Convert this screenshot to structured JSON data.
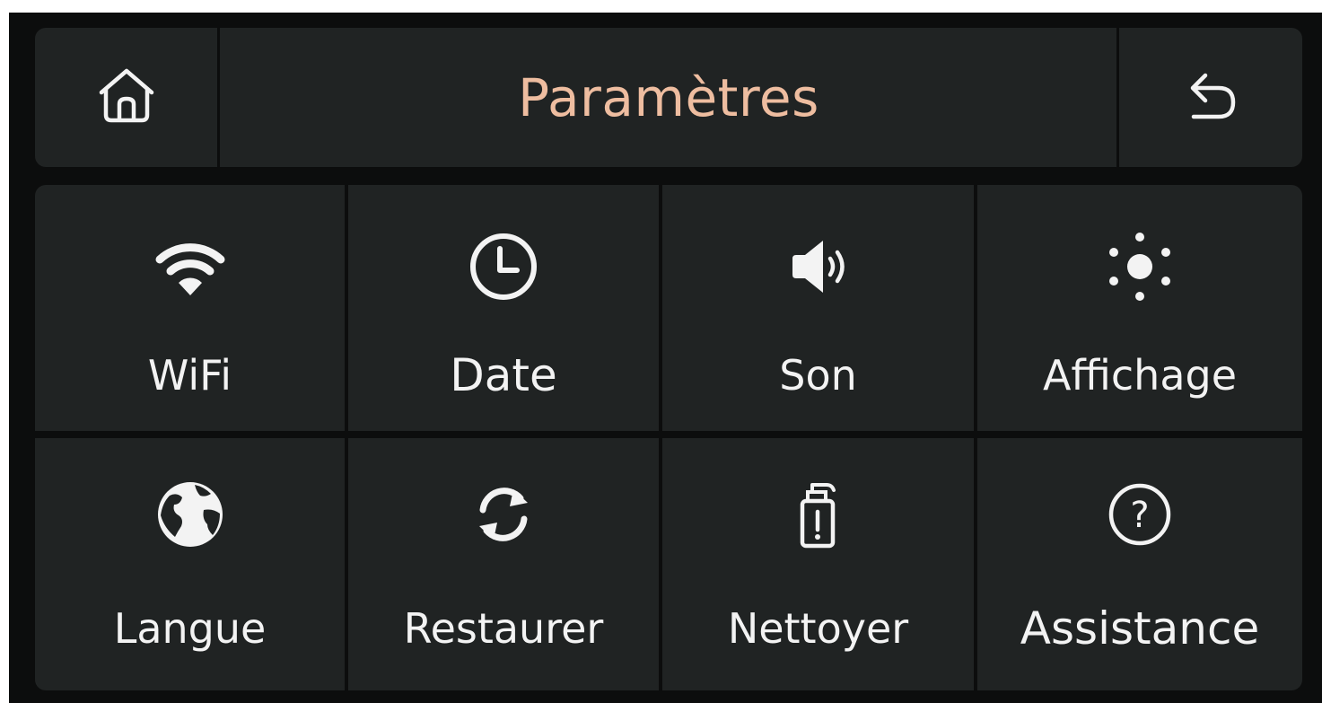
{
  "header": {
    "title": "Paramètres",
    "title_color": "#eebda0",
    "home_icon": "home-icon",
    "back_icon": "back-arrow-icon"
  },
  "menu": {
    "items": [
      {
        "label": "WiFi",
        "icon": "wifi-icon"
      },
      {
        "label": "Date",
        "icon": "clock-icon"
      },
      {
        "label": "Son",
        "icon": "speaker-icon"
      },
      {
        "label": "Affichage",
        "icon": "brightness-icon"
      },
      {
        "label": "Langue",
        "icon": "globe-icon"
      },
      {
        "label": "Restaurer",
        "icon": "restore-icon"
      },
      {
        "label": "Nettoyer",
        "icon": "cleaner-bottle-icon"
      },
      {
        "label": "Assistance",
        "icon": "help-icon"
      }
    ]
  },
  "colors": {
    "background": "#0c0d0d",
    "panel": "#202323",
    "text": "#f3f3f3"
  }
}
